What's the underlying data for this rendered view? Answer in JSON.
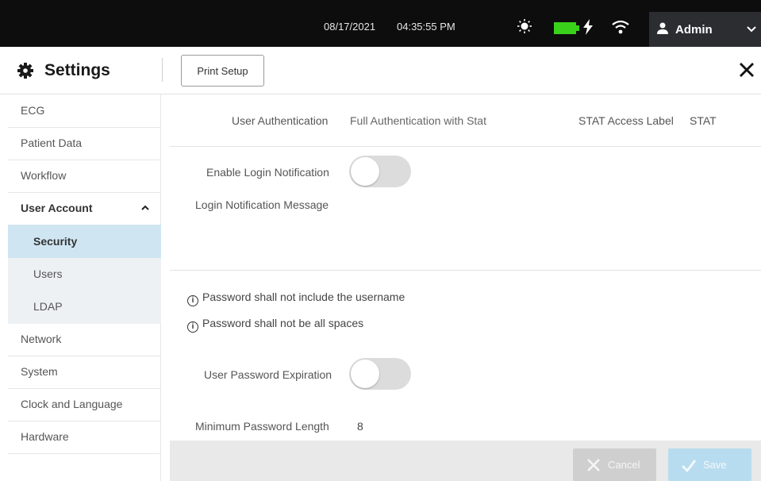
{
  "status_bar": {
    "date": "08/17/2021",
    "time": "04:35:55 PM",
    "user": "Admin"
  },
  "header": {
    "title": "Settings",
    "print_setup": "Print Setup"
  },
  "sidebar": {
    "items": [
      {
        "label": "ECG"
      },
      {
        "label": "Patient Data"
      },
      {
        "label": "Workflow"
      },
      {
        "label": "User Account"
      },
      {
        "label": "Security"
      },
      {
        "label": "Users"
      },
      {
        "label": "LDAP"
      },
      {
        "label": "Network"
      },
      {
        "label": "System"
      },
      {
        "label": "Clock and Language"
      },
      {
        "label": "Hardware"
      }
    ]
  },
  "main": {
    "user_auth_label": "User Authentication",
    "user_auth_value": "Full Authentication with Stat",
    "stat_label": "STAT Access Label",
    "stat_value": "STAT",
    "login_notif_label": "Enable Login Notification",
    "login_msg_label": "Login Notification Message",
    "info1": "Password shall not include the username",
    "info2": "Password shall not be all spaces",
    "pw_expiration_label": "User Password Expiration",
    "min_pw_label": "Minimum Password Length",
    "min_pw_value": "8"
  },
  "footer": {
    "cancel": "Cancel",
    "save": "Save"
  },
  "colors": {
    "topbar": "#0d0d0d",
    "battery": "#39d11a",
    "active_item": "#cfe6f2",
    "save_button": "#b8dcef"
  }
}
